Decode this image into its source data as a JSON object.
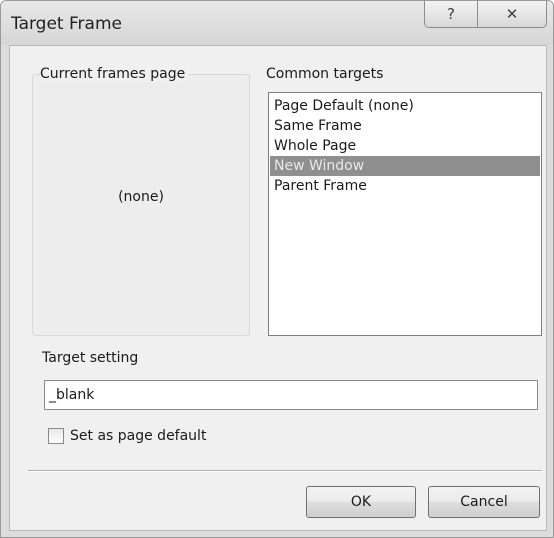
{
  "window": {
    "title": "Target Frame",
    "help_glyph": "?",
    "close_glyph": "✕"
  },
  "frames_panel": {
    "label": "Current frames page",
    "value": "(none)"
  },
  "common_targets": {
    "label": "Common targets",
    "items": [
      {
        "label": "Page Default (none)",
        "selected": false
      },
      {
        "label": "Same Frame",
        "selected": false
      },
      {
        "label": "Whole Page",
        "selected": false
      },
      {
        "label": "New Window",
        "selected": true
      },
      {
        "label": "Parent Frame",
        "selected": false
      }
    ]
  },
  "target_setting": {
    "label": "Target setting",
    "value": "_blank"
  },
  "page_default_checkbox": {
    "label": "Set as page default",
    "checked": false
  },
  "buttons": {
    "ok": "OK",
    "cancel": "Cancel"
  }
}
